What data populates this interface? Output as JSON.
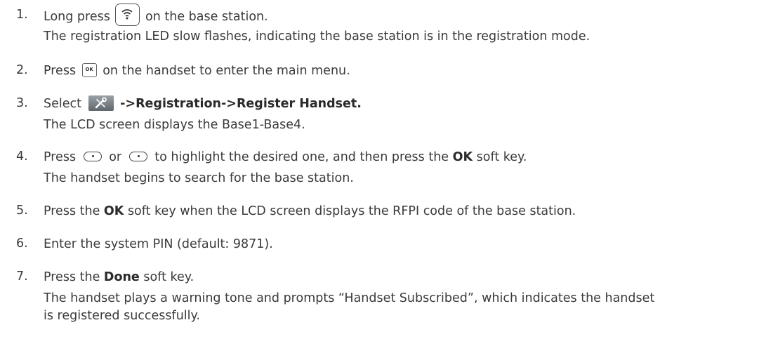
{
  "steps": [
    {
      "num": "1.",
      "lines": {
        "a_pre": "Long press",
        "a_post": "on the base station.",
        "b": "The registration LED slow flashes, indicating the base station is in the registration mode."
      }
    },
    {
      "num": "2.",
      "lines": {
        "a_pre": "Press",
        "a_post": "on the handset to enter the main menu."
      }
    },
    {
      "num": "3.",
      "lines": {
        "a_pre": "Select",
        "a_bold": "->Registration->Register Handset.",
        "b": "The LCD screen displays the Base1-Base4."
      }
    },
    {
      "num": "4.",
      "lines": {
        "a_pre": "Press",
        "a_mid": "or",
        "a_post1": "to highlight the desired one, and then press the",
        "a_bold": "OK",
        "a_post2": "soft key.",
        "b": "The handset begins to search for the base station."
      }
    },
    {
      "num": "5.",
      "lines": {
        "a_pre": "Press the",
        "a_bold": "OK",
        "a_post": "soft key when the LCD screen displays the RFPI code of the base station."
      }
    },
    {
      "num": "6.",
      "lines": {
        "a": "Enter the system PIN (default: 9871)."
      }
    },
    {
      "num": "7.",
      "lines": {
        "a_pre": "Press the",
        "a_bold": "Done",
        "a_post": "soft key.",
        "b": "The handset plays a warning tone and prompts “Handset Subscribed”, which indicates the handset",
        "c": "is registered successfully."
      }
    }
  ],
  "icons": {
    "ok_key_label": "OK"
  }
}
